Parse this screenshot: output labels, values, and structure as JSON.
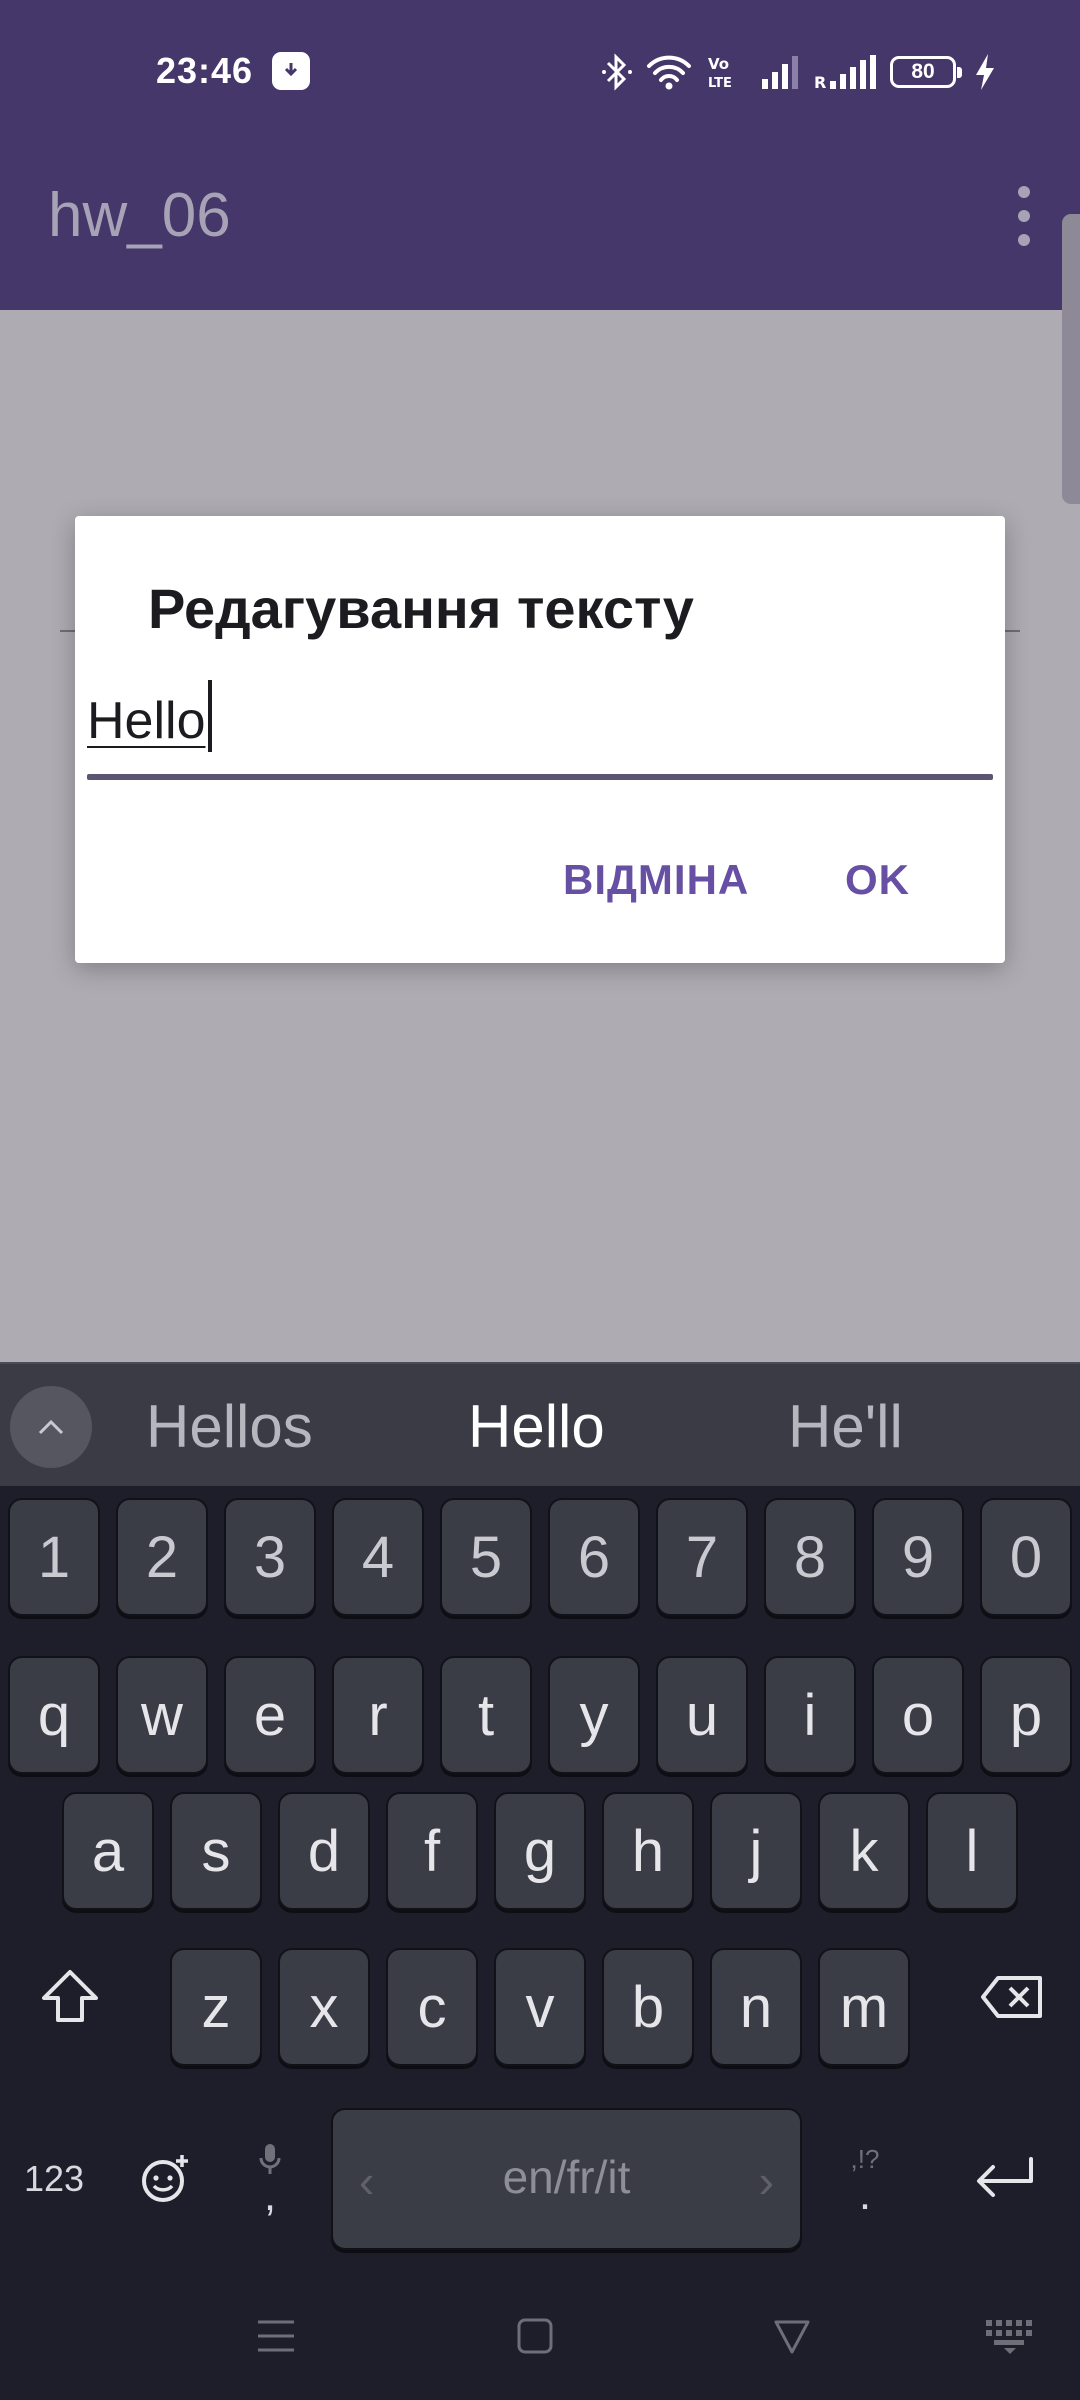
{
  "status_bar": {
    "time": "23:46",
    "battery": "80",
    "icons": [
      "bluetooth-icon",
      "wifi-icon",
      "volte-icon",
      "signal-icon",
      "roaming-signal-icon",
      "battery-icon",
      "charging-icon"
    ]
  },
  "app_bar": {
    "title": "hw_06"
  },
  "dialog": {
    "title": "Редагування тексту",
    "input_value": "Hello",
    "cancel_label": "ВІДМІНА",
    "ok_label": "OK"
  },
  "keyboard": {
    "suggestions": [
      "Hellos",
      "Hello",
      "He'll"
    ],
    "number_row": [
      "1",
      "2",
      "3",
      "4",
      "5",
      "6",
      "7",
      "8",
      "9",
      "0"
    ],
    "row1": [
      "q",
      "w",
      "e",
      "r",
      "t",
      "y",
      "u",
      "i",
      "o",
      "p"
    ],
    "row2": [
      "a",
      "s",
      "d",
      "f",
      "g",
      "h",
      "j",
      "k",
      "l"
    ],
    "row3": [
      "z",
      "x",
      "c",
      "v",
      "b",
      "n",
      "m"
    ],
    "symbols_label": "123",
    "comma_label": ",",
    "period_label": ".",
    "punct_hint": ",!?",
    "space_label": "en/fr/it"
  },
  "colors": {
    "app_bar": "#453769",
    "accent": "#6750a4",
    "keyboard_bg": "#1d1e2a",
    "key_bg": "#3a3c46"
  }
}
